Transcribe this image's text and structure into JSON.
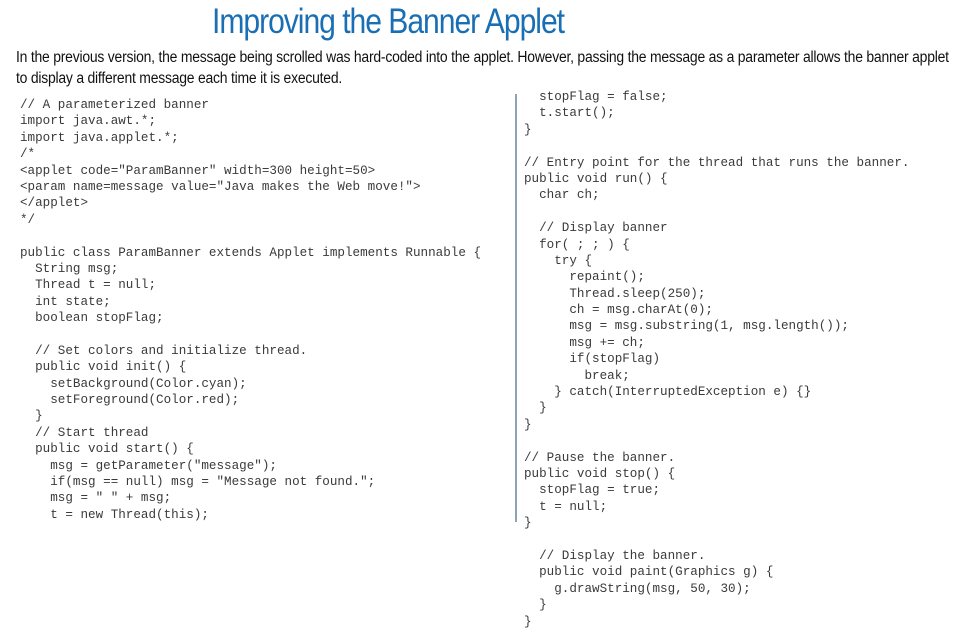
{
  "slide": {
    "title": "Improving the Banner Applet",
    "intro": "In the previous version, the message being scrolled was hard-coded into the applet. However, passing the message as a parameter allows the banner applet to display a different message each time it is executed."
  },
  "code": {
    "left_lines": [
      "// A parameterized banner",
      "import java.awt.*;",
      "import java.applet.*;",
      "/*",
      "<applet code=\"ParamBanner\" width=300 height=50>",
      "<param name=message value=\"Java makes the Web move!\">",
      "</applet>",
      "*/",
      "",
      "public class ParamBanner extends Applet implements Runnable {",
      "  String msg;",
      "  Thread t = null;",
      "  int state;",
      "  boolean stopFlag;",
      "",
      "  // Set colors and initialize thread.",
      "  public void init() {",
      "    setBackground(Color.cyan);",
      "    setForeground(Color.red);",
      "  }",
      "  // Start thread",
      "  public void start() {",
      "    msg = getParameter(\"message\");",
      "    if(msg == null) msg = \"Message not found.\";",
      "    msg = \" \" + msg;",
      "    t = new Thread(this);"
    ],
    "right_lines": [
      "  stopFlag = false;",
      "  t.start();",
      "}",
      "",
      "// Entry point for the thread that runs the banner.",
      "public void run() {",
      "  char ch;",
      "",
      "  // Display banner",
      "  for( ; ; ) {",
      "    try {",
      "      repaint();",
      "      Thread.sleep(250);",
      "      ch = msg.charAt(0);",
      "      msg = msg.substring(1, msg.length());",
      "      msg += ch;",
      "      if(stopFlag)",
      "        break;",
      "    } catch(InterruptedException e) {}",
      "  }",
      "}",
      "",
      "// Pause the banner.",
      "public void stop() {",
      "  stopFlag = true;",
      "  t = null;",
      "}",
      "",
      "  // Display the banner.",
      "  public void paint(Graphics g) {",
      "    g.drawString(msg, 50, 30);",
      "  }",
      "}"
    ]
  }
}
